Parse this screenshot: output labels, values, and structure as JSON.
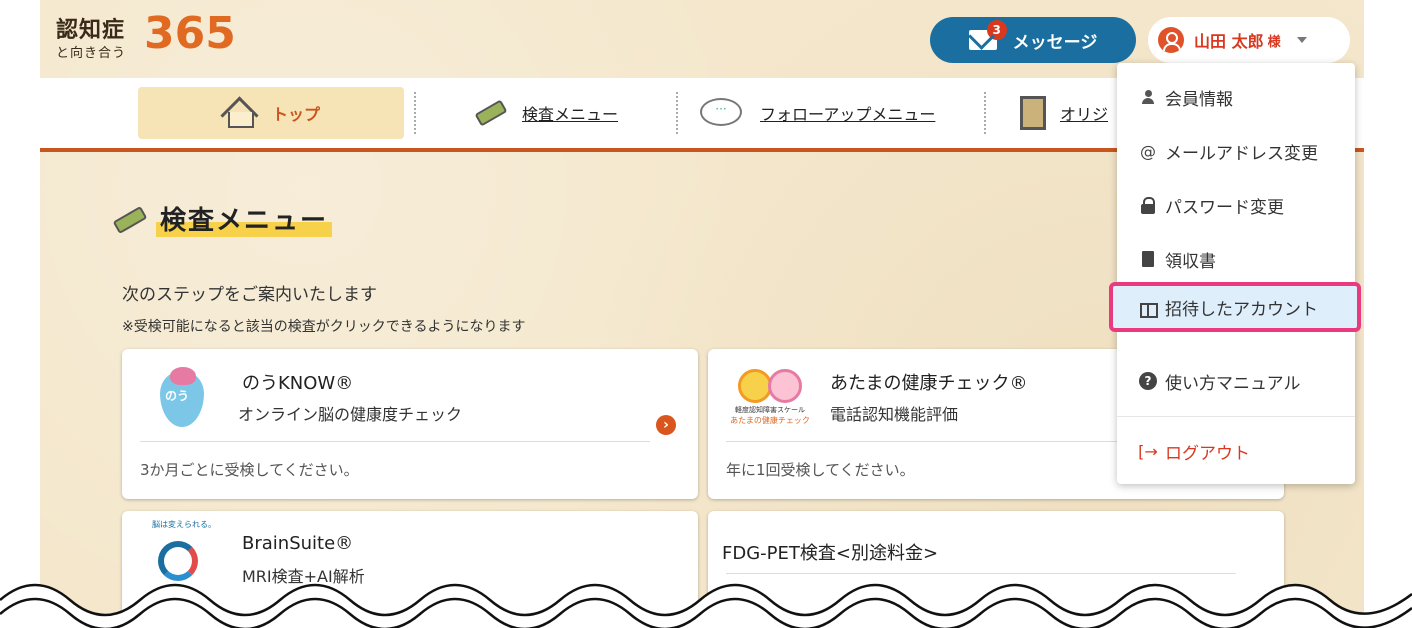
{
  "header": {
    "logo_kanji": "認知症",
    "logo_sub": "と向き合う",
    "logo_number": "365",
    "message_button": "メッセージ",
    "message_badge": "3",
    "user_name": "山田 太郎",
    "user_suffix": "様"
  },
  "nav": {
    "items": [
      {
        "label": "トップ",
        "icon": "house-icon",
        "active": true
      },
      {
        "label": "検査メニュー",
        "icon": "pencil-icon"
      },
      {
        "label": "フォローアップメニュー",
        "icon": "speech-bubble-icon"
      },
      {
        "label": "オリジ",
        "icon": "film-icon"
      }
    ]
  },
  "main": {
    "section_title": "検査メニュー",
    "intro": "次のステップをご案内いたします",
    "note": "※受検可能になると該当の検査がクリックできるようになります",
    "cards": [
      {
        "title": "のうKNOW®",
        "subtitle": "オンライン脳の健康度チェック",
        "footer": "3か月ごとに受検してください。",
        "logo_text": "のう"
      },
      {
        "title": "あたまの健康チェック®",
        "subtitle": "電話認知機能評価",
        "footer": "年に1回受検してください。",
        "logo_caption1": "軽度認知障害スケール",
        "logo_caption2": "あたまの健康チェック"
      },
      {
        "title": "BrainSuite®",
        "subtitle": "MRI検査+AI解析",
        "logo_caption": "脳は変えられる。"
      },
      {
        "title": "FDG-PET検査<別途料金>"
      }
    ]
  },
  "dropdown": {
    "items": [
      {
        "label": "会員情報",
        "icon": "person-icon"
      },
      {
        "label": "メールアドレス変更",
        "icon": "at-icon"
      },
      {
        "label": "パスワード変更",
        "icon": "lock-icon"
      },
      {
        "label": "領収書",
        "icon": "document-icon"
      },
      {
        "label": "招待したアカウント",
        "icon": "gift-icon",
        "highlighted": true
      },
      {
        "label": "使い方マニュアル",
        "icon": "help-icon"
      },
      {
        "label": "ログアウト",
        "icon": "logout-icon"
      }
    ]
  },
  "colors": {
    "accent": "#e06a22",
    "message_button": "#1a6fa0",
    "highlight_border": "#e93a80",
    "highlight_fill": "#dfeefb",
    "background": "#f4e7cc",
    "nav_border": "#c8561e"
  }
}
